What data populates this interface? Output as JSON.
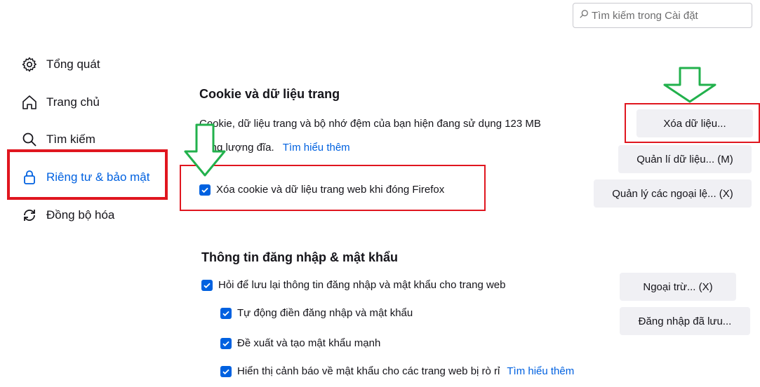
{
  "search": {
    "placeholder": "Tìm kiếm trong Cài đặt"
  },
  "sidebar": {
    "items": [
      {
        "label": "Tổng quát",
        "icon": "gear-icon"
      },
      {
        "label": "Trang chủ",
        "icon": "home-icon"
      },
      {
        "label": "Tìm kiếm",
        "icon": "search-icon"
      },
      {
        "label": "Riêng tư & bảo mật",
        "icon": "lock-icon",
        "active": true
      },
      {
        "label": "Đồng bộ hóa",
        "icon": "sync-icon"
      }
    ]
  },
  "cookies": {
    "heading": "Cookie và dữ liệu trang",
    "desc_line1": "Cookie, dữ liệu trang và bộ nhớ đệm của bạn hiện đang sử dụng 123 MB",
    "desc_line2": "dung lượng đĩa.",
    "learn_more": "Tìm hiểu thêm",
    "clear_on_close": {
      "label": "Xóa cookie và dữ liệu trang web khi đóng Firefox",
      "checked": true
    },
    "buttons": {
      "clear_data": "Xóa dữ liệu...",
      "manage_data": "Quản lí dữ liệu... (M)",
      "manage_exceptions": "Quản lý các ngoại lệ... (X)"
    }
  },
  "logins": {
    "heading": "Thông tin đăng nhập & mật khẩu",
    "ask_save": {
      "label": "Hỏi để lưu lại thông tin đăng nhập và mật khẩu cho trang web",
      "checked": true
    },
    "autofill": {
      "label": "Tự động điền đăng nhập và mật khẩu",
      "checked": true
    },
    "suggest": {
      "label": "Đề xuất và tạo mật khẩu mạnh",
      "checked": true
    },
    "breach_alerts": {
      "label": "Hiển thị cảnh báo về mật khẩu cho các trang web bị rò rỉ",
      "checked": true
    },
    "learn_more": "Tìm hiểu thêm",
    "buttons": {
      "exceptions": "Ngoại trừ... (X)",
      "saved_logins": "Đăng nhập đã lưu..."
    }
  },
  "colors": {
    "accent": "#0061e0",
    "highlight_box": "#e0161f",
    "arrow": "#22b14c"
  }
}
